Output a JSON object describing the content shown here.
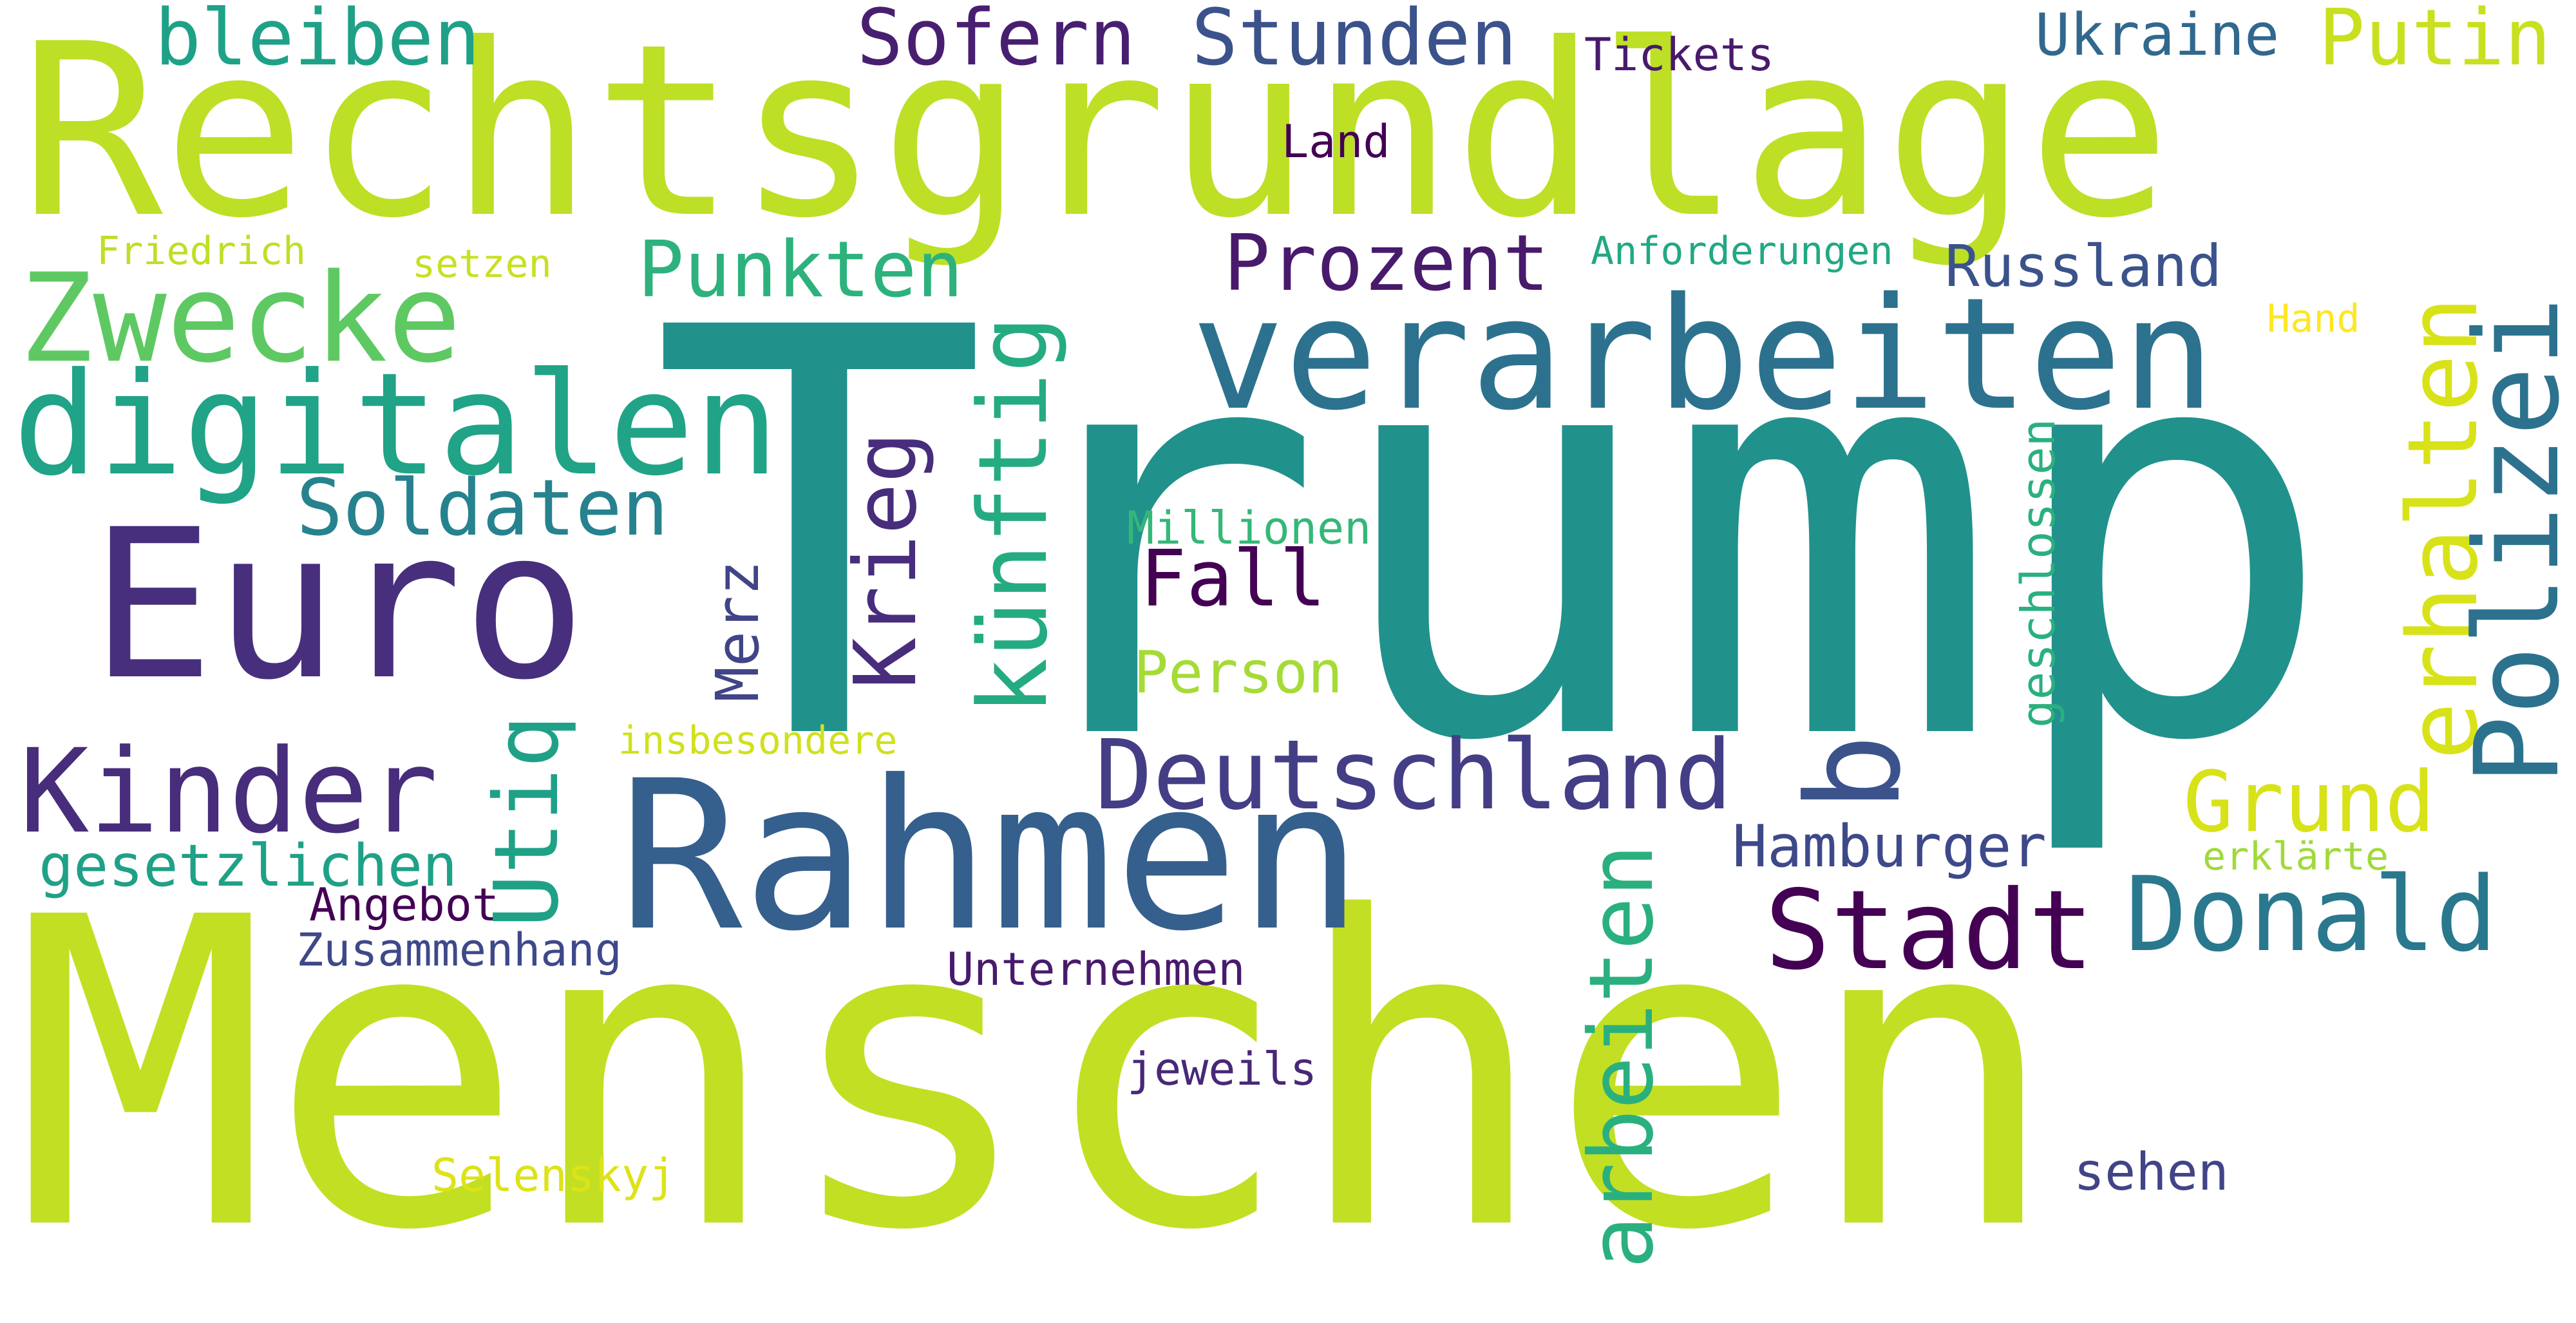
{
  "words": [
    {
      "text": "Rechtsgrundlage",
      "color": "#bddf26"
    },
    {
      "text": "Trump",
      "color": "#21918c"
    },
    {
      "text": "Menschen",
      "color": "#c2df23"
    },
    {
      "text": "Euro",
      "color": "#472f7d"
    },
    {
      "text": "Rahmen",
      "color": "#355f8d"
    },
    {
      "text": "verarbeiten",
      "color": "#2c728e"
    },
    {
      "text": "digitalen",
      "color": "#20a386"
    },
    {
      "text": "Zwecke",
      "color": "#5ec962"
    },
    {
      "text": "Kinder",
      "color": "#472d7b"
    },
    {
      "text": "Stadt",
      "color": "#440154"
    },
    {
      "text": "Donald",
      "color": "#2a788e"
    },
    {
      "text": "Deutschland",
      "color": "#433e85"
    },
    {
      "text": "Prozent",
      "color": "#481a6c"
    },
    {
      "text": "Punkten",
      "color": "#2db27d"
    },
    {
      "text": "Soldaten",
      "color": "#26828e"
    },
    {
      "text": "Grund",
      "color": "#d8e219"
    },
    {
      "text": "bleiben",
      "color": "#1fa187"
    },
    {
      "text": "Sofern",
      "color": "#481f70"
    },
    {
      "text": "Stunden",
      "color": "#3b528b"
    },
    {
      "text": "Putin",
      "color": "#c8e020"
    },
    {
      "text": "Ukraine",
      "color": "#31688e"
    },
    {
      "text": "Fall",
      "color": "#440154"
    },
    {
      "text": "Hamburger",
      "color": "#3e4989"
    },
    {
      "text": "Russland",
      "color": "#3b528b"
    },
    {
      "text": "Person",
      "color": "#a5db36"
    },
    {
      "text": "gesetzlichen",
      "color": "#1fa187"
    },
    {
      "text": "Zusammenhang",
      "color": "#3e4989"
    },
    {
      "text": "Angebot",
      "color": "#440154"
    },
    {
      "text": "Unternehmen",
      "color": "#481a6c"
    },
    {
      "text": "jeweils",
      "color": "#482878"
    },
    {
      "text": "sehen",
      "color": "#414487"
    },
    {
      "text": "Selenskyj",
      "color": "#dde318"
    },
    {
      "text": "insbesondere",
      "color": "#d0e11c"
    },
    {
      "text": "Millionen",
      "color": "#35b779"
    },
    {
      "text": "Friedrich",
      "color": "#bddf26"
    },
    {
      "text": "setzen",
      "color": "#c8e020"
    },
    {
      "text": "Anforderungen",
      "color": "#22a884"
    },
    {
      "text": "Land",
      "color": "#440154"
    },
    {
      "text": "Tickets",
      "color": "#481a6c"
    },
    {
      "text": "Hand",
      "color": "#fde725"
    },
    {
      "text": "erklärte",
      "color": "#a0da39"
    },
    {
      "text": "Krieg",
      "color": "#472d7b"
    },
    {
      "text": "künftig",
      "color": "#25ab82"
    },
    {
      "text": "Merz",
      "color": "#414487"
    },
    {
      "text": "Utiq",
      "color": "#1fa187"
    },
    {
      "text": "b",
      "color": "#3b528b"
    },
    {
      "text": "arbeiten",
      "color": "#2ab07f"
    },
    {
      "text": "erhalten",
      "color": "#d8e219"
    },
    {
      "text": "Polizei",
      "color": "#2c728e"
    },
    {
      "text": "geschlossen",
      "color": "#2ab07f"
    }
  ]
}
